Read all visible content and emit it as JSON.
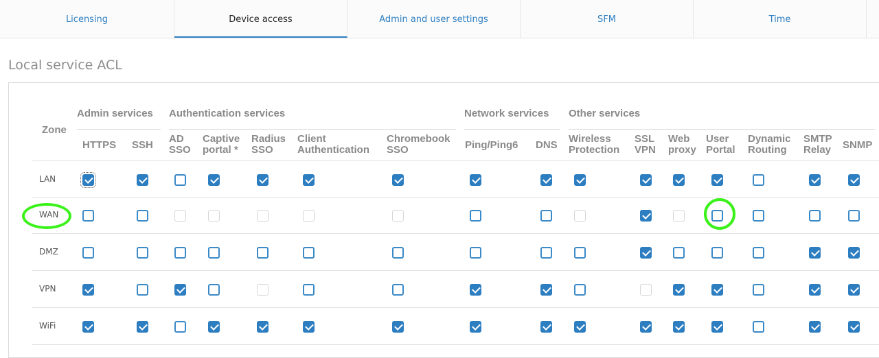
{
  "tabs": [
    {
      "label": "Licensing",
      "active": false
    },
    {
      "label": "Device access",
      "active": true
    },
    {
      "label": "Admin and user settings",
      "active": false
    },
    {
      "label": "SFM",
      "active": false
    },
    {
      "label": "Time",
      "active": false
    }
  ],
  "section_title": "Local service ACL",
  "zone_header": "Zone",
  "groups": [
    "Admin services",
    "Authentication services",
    "Network services",
    "Other services"
  ],
  "columns": [
    [
      "HTTPS",
      ""
    ],
    [
      "SSH",
      ""
    ],
    [
      "AD",
      "SSO"
    ],
    [
      "Captive",
      "portal *"
    ],
    [
      "Radius",
      "SSO"
    ],
    [
      "Client",
      "Authentication"
    ],
    [
      "Chromebook",
      "SSO"
    ],
    [
      "Ping/Ping6",
      ""
    ],
    [
      "DNS",
      ""
    ],
    [
      "Wireless",
      "Protection"
    ],
    [
      "SSL",
      "VPN"
    ],
    [
      "Web",
      "proxy"
    ],
    [
      "User",
      "Portal"
    ],
    [
      "Dynamic",
      "Routing"
    ],
    [
      "SMTP",
      "Relay"
    ],
    [
      "SNMP",
      ""
    ]
  ],
  "rows": [
    {
      "zone": "LAN",
      "values": [
        "on",
        "on",
        "off",
        "on",
        "on",
        "on",
        "on",
        "on",
        "on",
        "on",
        "on",
        "on",
        "on",
        "off",
        "on",
        "on"
      ]
    },
    {
      "zone": "WAN",
      "values": [
        "off",
        "off",
        "dis",
        "dis",
        "dis",
        "dis",
        "dis",
        "off",
        "off",
        "dis",
        "on",
        "dis",
        "off",
        "off",
        "off",
        "off"
      ]
    },
    {
      "zone": "DMZ",
      "values": [
        "off",
        "off",
        "off",
        "off",
        "off",
        "off",
        "off",
        "off",
        "off",
        "off",
        "on",
        "off",
        "off",
        "off",
        "on",
        "on"
      ]
    },
    {
      "zone": "VPN",
      "values": [
        "on",
        "off",
        "on",
        "off",
        "dis",
        "off",
        "off",
        "on",
        "on",
        "off",
        "dis",
        "on",
        "on",
        "off",
        "on",
        "on"
      ]
    },
    {
      "zone": "WiFi",
      "values": [
        "on",
        "on",
        "off",
        "on",
        "on",
        "on",
        "on",
        "on",
        "on",
        "on",
        "on",
        "on",
        "on",
        "off",
        "on",
        "on"
      ]
    }
  ],
  "colors": {
    "accent": "#2d7ec1",
    "highlight": "#3af21a"
  }
}
